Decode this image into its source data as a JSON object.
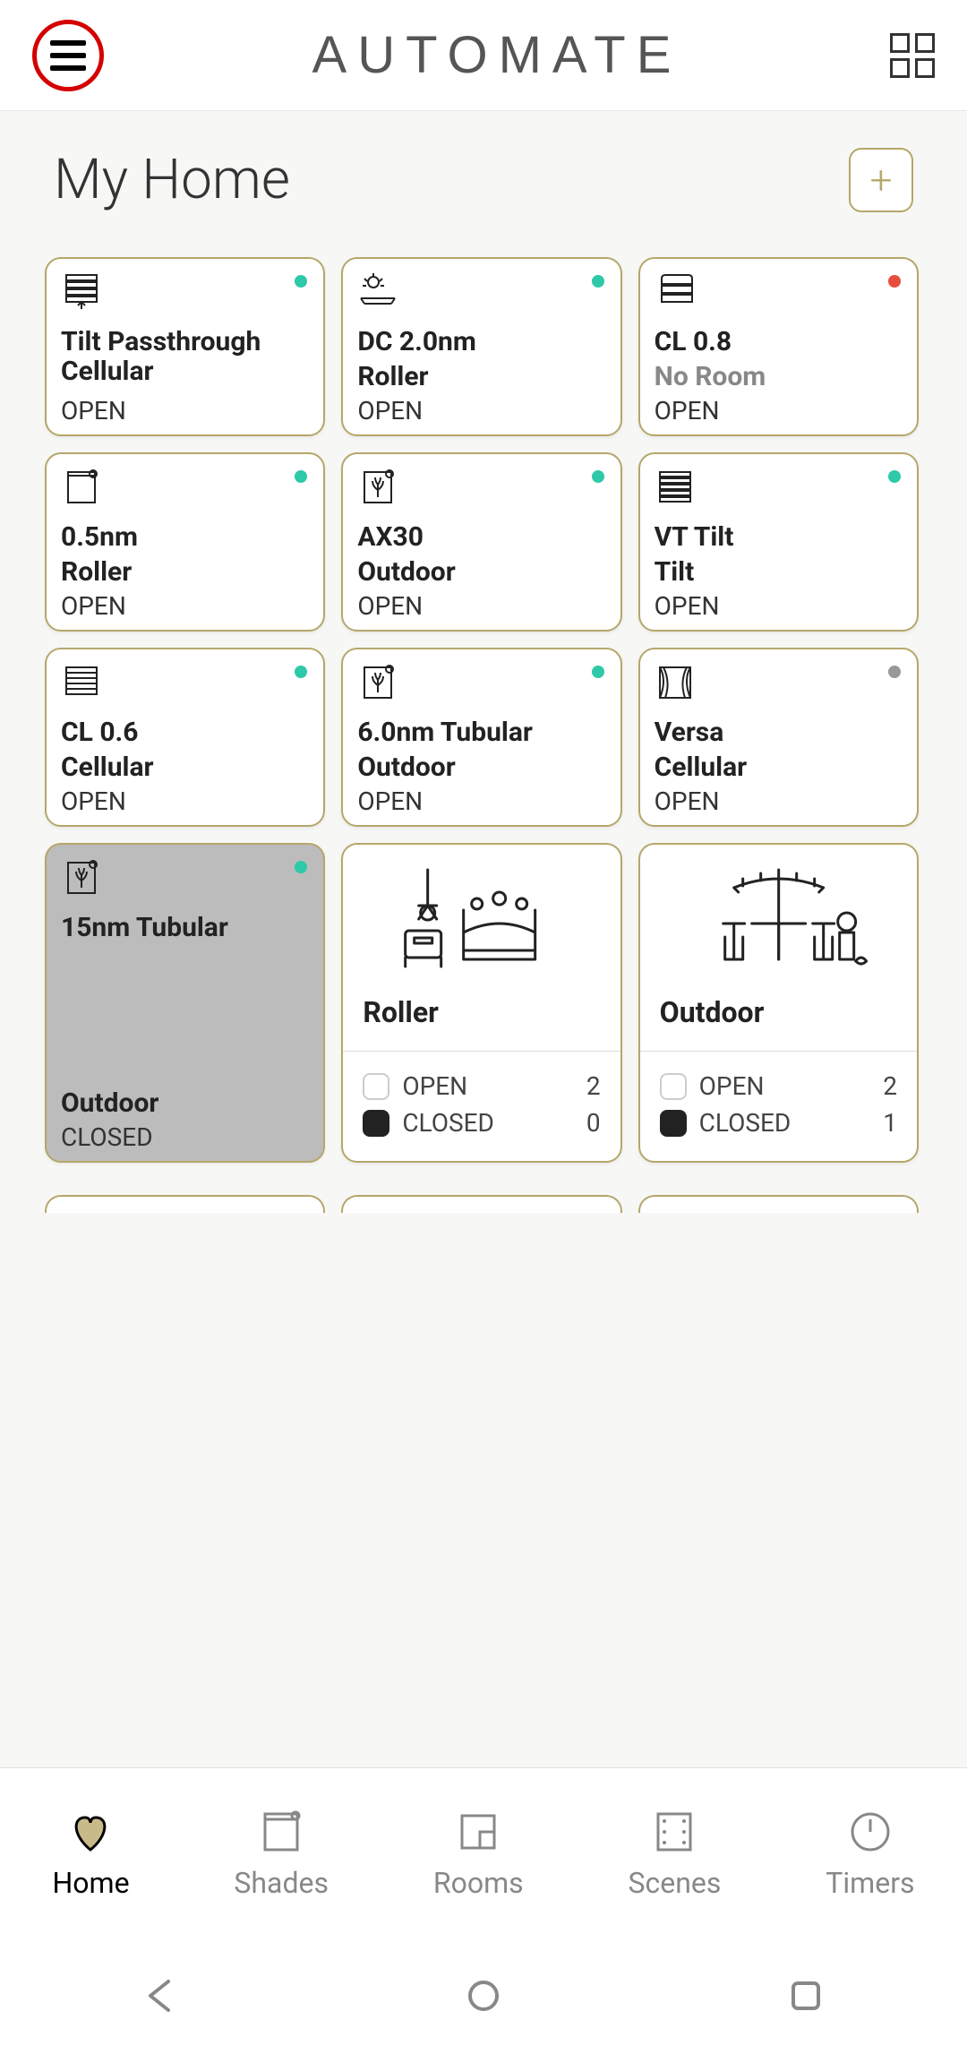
{
  "header": {
    "logo_text": "AUTOMATE"
  },
  "page": {
    "title": "My Home"
  },
  "devices": [
    {
      "name": "Tilt Passthrough Cellular",
      "room": "",
      "state": "OPEN",
      "status": "green",
      "icon": "blind"
    },
    {
      "name": "DC 2.0nm",
      "room": "Roller",
      "state": "OPEN",
      "status": "green",
      "icon": "sun"
    },
    {
      "name": "CL 0.8",
      "room": "No Room",
      "state": "OPEN",
      "status": "red",
      "icon": "shade",
      "noroom": true
    },
    {
      "name": "0.5nm",
      "room": "Roller",
      "state": "OPEN",
      "status": "green",
      "icon": "roller"
    },
    {
      "name": "AX30",
      "room": "Outdoor",
      "state": "OPEN",
      "status": "green",
      "icon": "plant"
    },
    {
      "name": "VT Tilt",
      "room": "Tilt",
      "state": "OPEN",
      "status": "green",
      "icon": "slats"
    },
    {
      "name": "CL 0.6",
      "room": "Cellular",
      "state": "OPEN",
      "status": "green",
      "icon": "cellular"
    },
    {
      "name": "6.0nm Tubular",
      "room": "Outdoor",
      "state": "OPEN",
      "status": "green",
      "icon": "plant"
    },
    {
      "name": "Versa",
      "room": "Cellular",
      "state": "OPEN",
      "status": "grey",
      "icon": "curtain"
    },
    {
      "name": "15nm Tubular",
      "room": "Outdoor",
      "state": "CLOSED",
      "status": "green",
      "icon": "plant",
      "closed": true
    }
  ],
  "rooms": [
    {
      "name": "Roller",
      "open_label": "OPEN",
      "open_count": "2",
      "closed_label": "CLOSED",
      "closed_count": "0",
      "illus": "bedroom"
    },
    {
      "name": "Outdoor",
      "open_label": "OPEN",
      "open_count": "2",
      "closed_label": "CLOSED",
      "closed_count": "1",
      "illus": "patio"
    }
  ],
  "tabs": [
    {
      "label": "Home",
      "active": true,
      "icon": "heart"
    },
    {
      "label": "Shades",
      "active": false,
      "icon": "shade"
    },
    {
      "label": "Rooms",
      "active": false,
      "icon": "room"
    },
    {
      "label": "Scenes",
      "active": false,
      "icon": "film"
    },
    {
      "label": "Timers",
      "active": false,
      "icon": "clock"
    }
  ]
}
